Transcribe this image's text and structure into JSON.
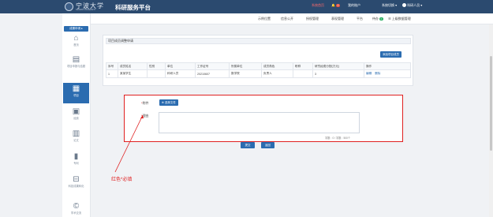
{
  "header": {
    "logo_text": "宁波大学",
    "logo_sub": "NINGBO UNIVERSITY",
    "title": "科研服务平台",
    "link_red": "系统首页",
    "bell_count": "0",
    "switch_label": "我的账户",
    "role_label": "系统切换",
    "user_name": "科研人员"
  },
  "nav": {
    "items": [
      "示例位置",
      "信息公开",
      "授权管理",
      "表现管理",
      "平台"
    ],
    "badge_item": "待办",
    "badge_count": "0",
    "last_item": "上级数据管理"
  },
  "sidebar": {
    "toggle": "成果申请 ▸",
    "items": [
      {
        "label": "首页",
        "icon": "home-icon"
      },
      {
        "label": "项目申报与结题",
        "icon": "document-icon"
      },
      {
        "label": "项目",
        "icon": "project-icon",
        "active": true
      },
      {
        "label": "经费",
        "icon": "money-icon"
      },
      {
        "label": "论文",
        "icon": "paper-icon"
      },
      {
        "label": "专利",
        "icon": "bookmark-icon"
      },
      {
        "label": "科技成果转化",
        "icon": "transfer-icon"
      },
      {
        "label": "学术交流",
        "icon": "copyright-icon"
      }
    ]
  },
  "panel": {
    "title": "项目成员调整申请",
    "add_button": "添加项目成员"
  },
  "table": {
    "headers": [
      "序号",
      "成员姓名",
      "性别",
      "单位",
      "工作证号",
      "所属单位",
      "成员角色",
      "职称",
      "研究经费分配(万元)",
      "操作"
    ],
    "rows": [
      {
        "no": "1",
        "name": "某某学生",
        "gender": "",
        "unit": "科研人员",
        "id": "20210607",
        "dept": "数学院",
        "role": "负责人",
        "title": "",
        "funds": "3",
        "edit": "编辑",
        "delete": "删除"
      }
    ]
  },
  "form": {
    "attach_label": "附件",
    "file_button": "选择文件",
    "reason_label": "理由",
    "counter": "字数：0 / 字数：500个"
  },
  "buttons": {
    "submit": "提交",
    "back": "返回"
  },
  "annotation": "红色*必填",
  "colors": {
    "header_bg": "#2b4a6f",
    "primary": "#2b6cb0",
    "required_red": "#e02020"
  }
}
